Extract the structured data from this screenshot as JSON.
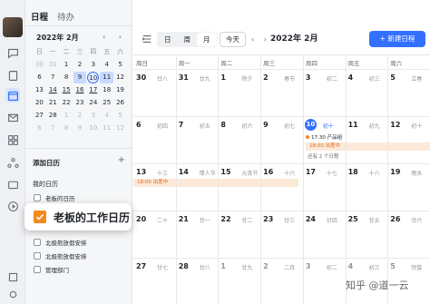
{
  "sidebar": {
    "tabs": [
      {
        "label": "日程",
        "active": true
      },
      {
        "label": "待办",
        "active": false
      }
    ],
    "mini_month": "2022年 2月",
    "mini_nav": "‹ ›",
    "weekdays": [
      "日",
      "一",
      "二",
      "三",
      "四",
      "五",
      "六"
    ],
    "mini_days": [
      [
        "30",
        "31",
        "1",
        "2",
        "3",
        "4",
        "5"
      ],
      [
        "6",
        "7",
        "8",
        "9",
        "10",
        "11",
        "12"
      ],
      [
        "13",
        "14",
        "15",
        "16",
        "17",
        "18",
        "19"
      ],
      [
        "20",
        "21",
        "22",
        "23",
        "24",
        "25",
        "26"
      ],
      [
        "27",
        "28",
        "1",
        "2",
        "3",
        "4",
        "5"
      ],
      [
        "6",
        "7",
        "8",
        "9",
        "10",
        "11",
        "12"
      ]
    ],
    "add_calendar": "添加日历",
    "my_calendars": "我的日历",
    "calendars": [
      "老板的日历",
      "老板的工作日历",
      "北极熊放假安排",
      "北极熊放假安排",
      "管理部门"
    ],
    "popup_label": "老板的工作日历"
  },
  "toolbar": {
    "views": [
      {
        "label": "日",
        "active": false
      },
      {
        "label": "周",
        "active": false
      },
      {
        "label": "月",
        "active": true
      }
    ],
    "today": "今天",
    "arrows": "‹ ›",
    "month": "2022年 2月",
    "new_event": "+ 新建日程"
  },
  "calendar": {
    "headers": [
      "周日",
      "周一",
      "周二",
      "周三",
      "周四",
      "周五",
      "周六"
    ],
    "weeks": [
      [
        {
          "d": "30",
          "l": "廿八"
        },
        {
          "d": "31",
          "l": "廿九"
        },
        {
          "d": "1",
          "l": "除夕"
        },
        {
          "d": "2",
          "l": "春节"
        },
        {
          "d": "3",
          "l": "初二"
        },
        {
          "d": "4",
          "l": "初三"
        },
        {
          "d": "5",
          "l": "立春"
        }
      ],
      [
        {
          "d": "6",
          "l": "初四"
        },
        {
          "d": "7",
          "l": "初五"
        },
        {
          "d": "8",
          "l": "初六"
        },
        {
          "d": "9",
          "l": "初七"
        },
        {
          "d": "10",
          "l": "初十",
          "today": true
        },
        {
          "d": "11",
          "l": "初九"
        },
        {
          "d": "12",
          "l": "初十"
        }
      ],
      [
        {
          "d": "13",
          "l": "十三"
        },
        {
          "d": "14",
          "l": "情人节"
        },
        {
          "d": "15",
          "l": "元宵节"
        },
        {
          "d": "16",
          "l": "十六"
        },
        {
          "d": "17",
          "l": "十七"
        },
        {
          "d": "18",
          "l": "十八"
        },
        {
          "d": "19",
          "l": "雨水"
        }
      ],
      [
        {
          "d": "20",
          "l": "二十"
        },
        {
          "d": "21",
          "l": "廿一"
        },
        {
          "d": "22",
          "l": "廿二"
        },
        {
          "d": "23",
          "l": "廿三"
        },
        {
          "d": "24",
          "l": "廿四"
        },
        {
          "d": "25",
          "l": "廿五"
        },
        {
          "d": "26",
          "l": "廿六"
        }
      ],
      [
        {
          "d": "27",
          "l": "廿七"
        },
        {
          "d": "28",
          "l": "廿八"
        },
        {
          "d": "1",
          "l": "廿九",
          "dim": true
        },
        {
          "d": "2",
          "l": "二月",
          "dim": true
        },
        {
          "d": "3",
          "l": "初二",
          "dim": true
        },
        {
          "d": "4",
          "l": "初三",
          "dim": true
        },
        {
          "d": "5",
          "l": "惊蛰",
          "dim": true
        }
      ]
    ],
    "events": {
      "thu10_event": "17:30 产品组",
      "bar_w2": "18:00 出差中",
      "more_w2": "还有 2 个日程",
      "bar_w3": "18:00 出差中"
    }
  },
  "watermark": "知乎 @道一云"
}
